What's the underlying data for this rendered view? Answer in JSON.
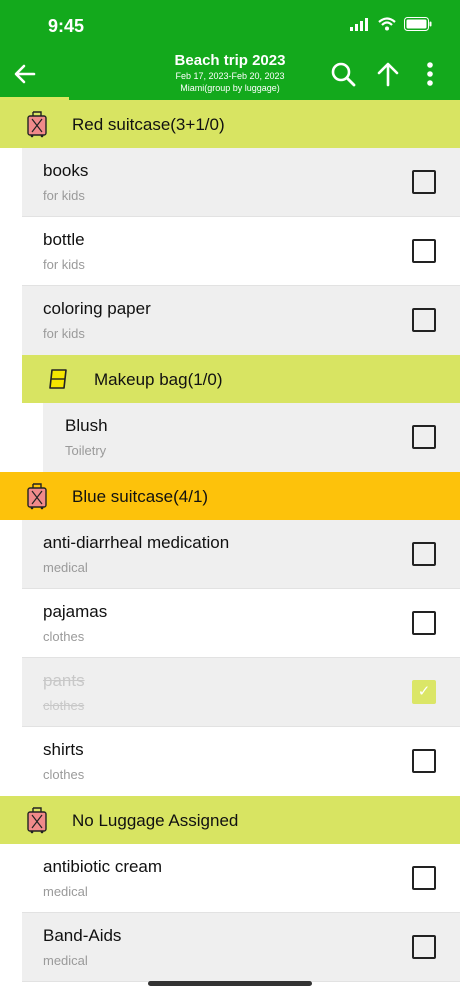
{
  "status": {
    "time": "9:45"
  },
  "header": {
    "title": "Beach trip 2023",
    "dates": "Feb 17, 2023-Feb 20, 2023",
    "location": "Miami(group by luggage)",
    "progress_fraction": 0.15
  },
  "colors": {
    "header": "#13a91c",
    "group_default": "#d8e462",
    "group_active": "#fdc20b"
  },
  "groups": [
    {
      "label": "Red suitcase(3+1/0)",
      "items": [
        {
          "name": "books",
          "category": "for kids",
          "checked": false
        },
        {
          "name": "bottle",
          "category": "for kids",
          "checked": false
        },
        {
          "name": "coloring paper",
          "category": "for kids",
          "checked": false
        }
      ],
      "subgroup": {
        "label": "Makeup bag(1/0)",
        "items": [
          {
            "name": "Blush",
            "category": "Toiletry",
            "checked": false
          }
        ]
      }
    },
    {
      "label": "Blue suitcase(4/1)",
      "items": [
        {
          "name": "anti-diarrheal medication",
          "category": "medical",
          "checked": false
        },
        {
          "name": "pajamas",
          "category": "clothes",
          "checked": false
        },
        {
          "name": "pants",
          "category": "clothes",
          "checked": true
        },
        {
          "name": "shirts",
          "category": "clothes",
          "checked": false
        }
      ]
    },
    {
      "label": "No Luggage Assigned",
      "items": [
        {
          "name": "antibiotic cream",
          "category": "medical",
          "checked": false
        },
        {
          "name": "Band-Aids",
          "category": "medical",
          "checked": false
        }
      ]
    }
  ]
}
